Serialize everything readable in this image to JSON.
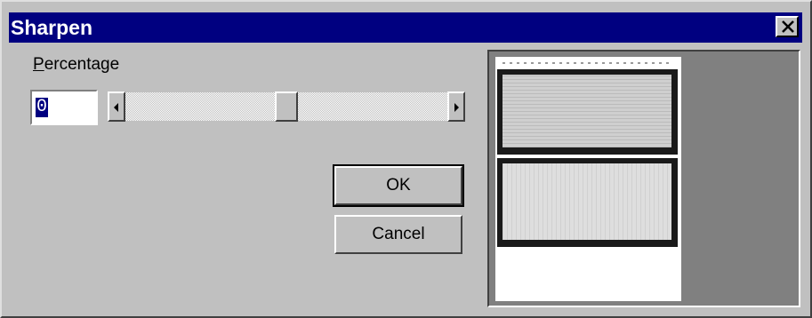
{
  "window": {
    "title": "Sharpen",
    "close_icon": "close-icon"
  },
  "percentage": {
    "label_first": "P",
    "label_rest": "ercentage",
    "value": "0",
    "slider_level": 0.5
  },
  "buttons": {
    "ok": "OK",
    "cancel": "Cancel"
  },
  "preview": {
    "icon": "document-preview"
  }
}
